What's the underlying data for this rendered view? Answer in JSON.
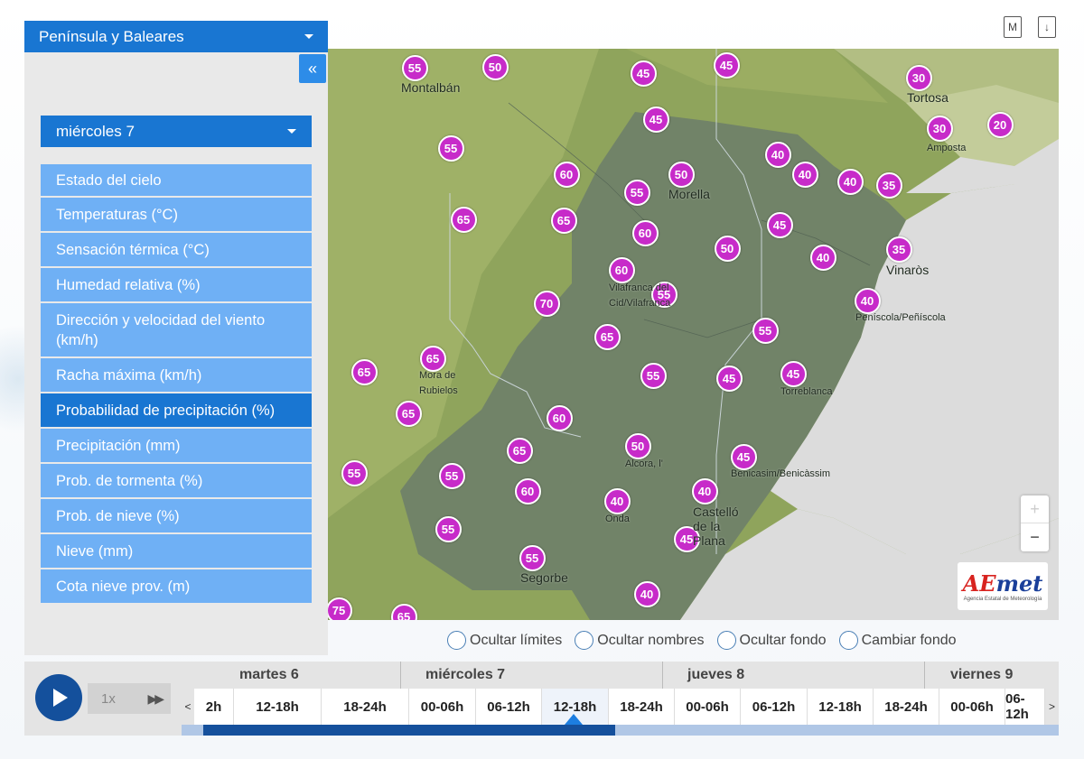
{
  "region": "Península y Baleares",
  "collapse_label": "«",
  "day_selector": "miércoles 7",
  "menu": [
    {
      "label": "Estado del cielo",
      "active": false
    },
    {
      "label": "Temperaturas (°C)",
      "active": false
    },
    {
      "label": "Sensación térmica (°C)",
      "active": false
    },
    {
      "label": "Humedad relativa (%)",
      "active": false
    },
    {
      "label": "Dirección y velocidad del viento (km/h)",
      "active": false
    },
    {
      "label": "Racha máxima (km/h)",
      "active": false
    },
    {
      "label": "Probabilidad de precipitación (%)",
      "active": true
    },
    {
      "label": "Precipitación (mm)",
      "active": false
    },
    {
      "label": "Prob. de tormenta (%)",
      "active": false
    },
    {
      "label": "Prob. de nieve (%)",
      "active": false
    },
    {
      "label": "Nieve (mm)",
      "active": false
    },
    {
      "label": "Cota nieve prov. (m)",
      "active": false
    }
  ],
  "top_icons": [
    {
      "name": "pdf-icon",
      "glyph": "M"
    },
    {
      "name": "download-icon",
      "glyph": "↓"
    }
  ],
  "places": [
    "Montalbán",
    "Tortosa",
    "Amposta",
    "Morella",
    "Vinaròs",
    "Vilafranca del Cid/Vilafranca",
    "Peníscola/Peñíscola",
    "Mora de Rubielos",
    "Torreblanca",
    "Alcora, l'",
    "Benicasim/Benicàssim",
    "Onda",
    "Castelló de la Plana",
    "Segorbe"
  ],
  "precip_values": [
    "55",
    "50",
    "45",
    "45",
    "30",
    "45",
    "30",
    "20",
    "55",
    "60",
    "50",
    "40",
    "40",
    "40",
    "35",
    "55",
    "Morella",
    "65",
    "65",
    "60",
    "45",
    "50",
    "40",
    "35",
    "60",
    "55",
    "70",
    "65",
    "55",
    "40",
    "65",
    "65",
    "55",
    "45",
    "45",
    "65",
    "60",
    "65",
    "50",
    "45",
    "55",
    "60",
    "40",
    "40",
    "55",
    "45",
    "55",
    "55",
    "40",
    "75",
    "65"
  ],
  "zoom": {
    "in": "+",
    "out": "−"
  },
  "logo": {
    "main_a": "A",
    "main_e": "E",
    "main_rest": "met",
    "sub": "Agencia Estatal de Meteorología"
  },
  "checkboxes": [
    "Ocultar límites",
    "Ocultar nombres",
    "Ocultar fondo",
    "Cambiar fondo"
  ],
  "timeline": {
    "speed": "1x",
    "days": [
      "martes 6",
      "miércoles 7",
      "jueves 8",
      "viernes 9"
    ],
    "slots": [
      "2h",
      "12-18h",
      "18-24h",
      "00-06h",
      "06-12h",
      "12-18h",
      "18-24h",
      "00-06h",
      "06-12h",
      "12-18h",
      "18-24h",
      "00-06h",
      "06-12h"
    ],
    "selected_slot": 5,
    "progress_fraction": 0.47
  }
}
